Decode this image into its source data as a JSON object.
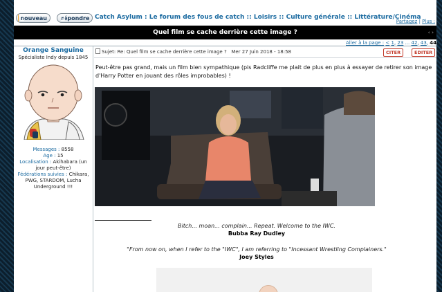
{
  "buttons": {
    "new_label": "nouveau",
    "reply_label": "répondre"
  },
  "breadcrumb": {
    "forum": "Catch Asylum : Le forum des fous de catch",
    "section": "Loisirs",
    "subsection": "Culture générale",
    "category": "Littérature/Cinéma",
    "separator": "::"
  },
  "top_links": {
    "share": "Partagez",
    "more": "Plus :"
  },
  "topic": {
    "title": "Quel film se cache derrière cette image ?",
    "nav_arrows": "‹ ›"
  },
  "pager": {
    "label": "Aller à la page :",
    "prev": "<",
    "p1": "1",
    "p23": "23",
    "ellipsis": "...",
    "p42": "42",
    "p43": "43",
    "current": "44"
  },
  "author": {
    "name": "Orange Sanguine",
    "rank": "Spécialiste Indy depuis 1845",
    "messages_label": "Messages :",
    "messages": "8558",
    "age_label": "Age :",
    "age": "15",
    "location_label": "Localisation :",
    "location": "Akihabara (un jour peut-être)",
    "federations_label": "Fédérations suivies :",
    "federations": "Chikara, PWG, STARDOM, Lucha Underground !!!"
  },
  "post": {
    "subject": "Sujet: Re: Quel film se cache derrière cette image ?",
    "date": "Mer 27 Juin 2018 - 18:58",
    "quote_label": "CITER",
    "edit_label": "EDITER",
    "body": "Peut-être pas grand, mais un film bien sympathique (pis Radcliffe me plait de plus en plus à essayer de retirer son image d'Harry Potter en jouant des rôles improbables) !"
  },
  "signature": {
    "quote1": "Bitch... moan... complain... Repeat. Welcome to the IWC.",
    "author1": "Bubba Ray Dudley",
    "quote2": "\"From now on, when I refer to the \"IWC\", I am referring to \"Incessant Wrestling Complainers.\"",
    "author2": "Joey Styles"
  },
  "colors": {
    "link": "#1a6aa0",
    "title_bar": "#000000",
    "action_button": "#c23a2a",
    "background_pattern": "#0e2233"
  },
  "icons": {
    "new": "pencil-icon",
    "reply": "reply-icon",
    "subject": "document-icon"
  }
}
